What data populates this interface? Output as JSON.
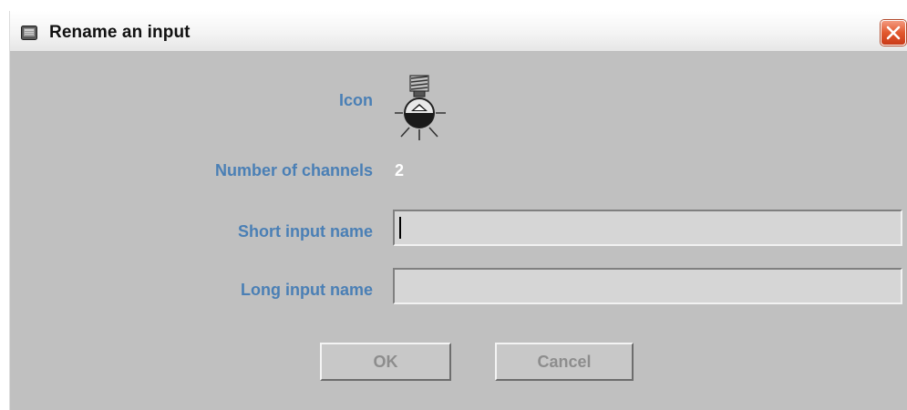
{
  "window": {
    "title": "Rename an input",
    "close_label": "Close"
  },
  "form": {
    "icon_label": "Icon",
    "channels_label": "Number of channels",
    "channels_value": "2",
    "short_name_label": "Short input name",
    "short_name_value": "",
    "long_name_label": "Long input name",
    "long_name_value": ""
  },
  "buttons": {
    "ok_label": "OK",
    "cancel_label": "Cancel"
  },
  "icons": {
    "window": "dialog-app-icon",
    "close": "close-icon",
    "device": "light-sensor-icon"
  },
  "colors": {
    "label": "#4a7fb5",
    "background": "#c0c0c0",
    "close_button": "#e2592f"
  }
}
